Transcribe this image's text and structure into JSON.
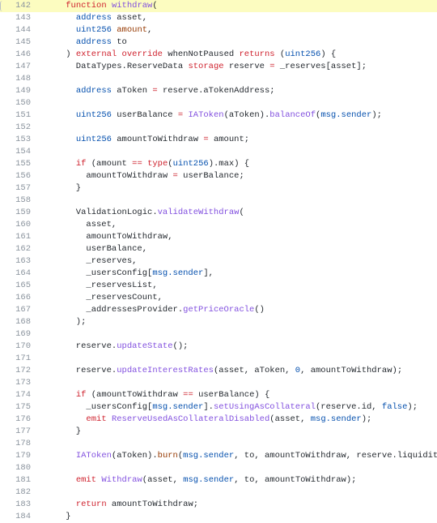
{
  "editor": {
    "language": "solidity",
    "theme": "github-light",
    "background_color": "#ffffff",
    "gutter_color": "#8b949e",
    "highlight_color": "#fcfcc0",
    "highlighted_line": 142,
    "first_line": 142,
    "last_line": 184,
    "fold_marker_icon": "fold-bracket-icon"
  },
  "palette": {
    "keyword": "#cf222e",
    "type": "#0550ae",
    "function": "#8250df",
    "variable": "#953800",
    "plain": "#24292f",
    "global": "#0550ae"
  },
  "lines": [
    {
      "number": "142",
      "highlighted": true,
      "tokens": [
        {
          "t": "    ",
          "c": "plain"
        },
        {
          "t": "function",
          "c": "kw"
        },
        {
          "t": " ",
          "c": "plain"
        },
        {
          "t": "withdraw",
          "c": "fn"
        },
        {
          "t": "(",
          "c": "plain"
        }
      ]
    },
    {
      "number": "143",
      "highlighted": false,
      "tokens": [
        {
          "t": "      ",
          "c": "plain"
        },
        {
          "t": "address",
          "c": "type"
        },
        {
          "t": " asset,",
          "c": "plain"
        }
      ]
    },
    {
      "number": "144",
      "highlighted": false,
      "tokens": [
        {
          "t": "      ",
          "c": "plain"
        },
        {
          "t": "uint256",
          "c": "type"
        },
        {
          "t": " ",
          "c": "plain"
        },
        {
          "t": "amount",
          "c": "var"
        },
        {
          "t": ",",
          "c": "plain"
        }
      ]
    },
    {
      "number": "145",
      "highlighted": false,
      "tokens": [
        {
          "t": "      ",
          "c": "plain"
        },
        {
          "t": "address",
          "c": "type"
        },
        {
          "t": " to",
          "c": "plain"
        }
      ]
    },
    {
      "number": "146",
      "highlighted": false,
      "tokens": [
        {
          "t": "    ) ",
          "c": "plain"
        },
        {
          "t": "external",
          "c": "kw"
        },
        {
          "t": " ",
          "c": "plain"
        },
        {
          "t": "override",
          "c": "kw"
        },
        {
          "t": " whenNotPaused ",
          "c": "plain"
        },
        {
          "t": "returns",
          "c": "kw"
        },
        {
          "t": " (",
          "c": "plain"
        },
        {
          "t": "uint256",
          "c": "type"
        },
        {
          "t": ") {",
          "c": "plain"
        }
      ]
    },
    {
      "number": "147",
      "highlighted": false,
      "tokens": [
        {
          "t": "      DataTypes.ReserveData ",
          "c": "plain"
        },
        {
          "t": "storage",
          "c": "kw"
        },
        {
          "t": " reserve ",
          "c": "plain"
        },
        {
          "t": "=",
          "c": "op"
        },
        {
          "t": " _reserves[asset];",
          "c": "plain"
        }
      ]
    },
    {
      "number": "148",
      "highlighted": false,
      "tokens": []
    },
    {
      "number": "149",
      "highlighted": false,
      "tokens": [
        {
          "t": "      ",
          "c": "plain"
        },
        {
          "t": "address",
          "c": "type"
        },
        {
          "t": " aToken ",
          "c": "plain"
        },
        {
          "t": "=",
          "c": "op"
        },
        {
          "t": " reserve.aTokenAddress;",
          "c": "plain"
        }
      ]
    },
    {
      "number": "150",
      "highlighted": false,
      "tokens": []
    },
    {
      "number": "151",
      "highlighted": false,
      "tokens": [
        {
          "t": "      ",
          "c": "plain"
        },
        {
          "t": "uint256",
          "c": "type"
        },
        {
          "t": " userBalance ",
          "c": "plain"
        },
        {
          "t": "=",
          "c": "op"
        },
        {
          "t": " ",
          "c": "plain"
        },
        {
          "t": "IAToken",
          "c": "fn"
        },
        {
          "t": "(aToken).",
          "c": "plain"
        },
        {
          "t": "balanceOf",
          "c": "fn"
        },
        {
          "t": "(",
          "c": "plain"
        },
        {
          "t": "msg.sender",
          "c": "global"
        },
        {
          "t": ");",
          "c": "plain"
        }
      ]
    },
    {
      "number": "152",
      "highlighted": false,
      "tokens": []
    },
    {
      "number": "153",
      "highlighted": false,
      "tokens": [
        {
          "t": "      ",
          "c": "plain"
        },
        {
          "t": "uint256",
          "c": "type"
        },
        {
          "t": " amountToWithdraw ",
          "c": "plain"
        },
        {
          "t": "=",
          "c": "op"
        },
        {
          "t": " amount;",
          "c": "plain"
        }
      ]
    },
    {
      "number": "154",
      "highlighted": false,
      "tokens": []
    },
    {
      "number": "155",
      "highlighted": false,
      "tokens": [
        {
          "t": "      ",
          "c": "plain"
        },
        {
          "t": "if",
          "c": "kw"
        },
        {
          "t": " (amount ",
          "c": "plain"
        },
        {
          "t": "==",
          "c": "op"
        },
        {
          "t": " ",
          "c": "plain"
        },
        {
          "t": "type",
          "c": "kw"
        },
        {
          "t": "(",
          "c": "plain"
        },
        {
          "t": "uint256",
          "c": "type"
        },
        {
          "t": ").max) {",
          "c": "plain"
        }
      ]
    },
    {
      "number": "156",
      "highlighted": false,
      "tokens": [
        {
          "t": "        amountToWithdraw ",
          "c": "plain"
        },
        {
          "t": "=",
          "c": "op"
        },
        {
          "t": " userBalance;",
          "c": "plain"
        }
      ]
    },
    {
      "number": "157",
      "highlighted": false,
      "tokens": [
        {
          "t": "      }",
          "c": "plain"
        }
      ]
    },
    {
      "number": "158",
      "highlighted": false,
      "tokens": []
    },
    {
      "number": "159",
      "highlighted": false,
      "tokens": [
        {
          "t": "      ValidationLogic.",
          "c": "plain"
        },
        {
          "t": "validateWithdraw",
          "c": "fn"
        },
        {
          "t": "(",
          "c": "plain"
        }
      ]
    },
    {
      "number": "160",
      "highlighted": false,
      "tokens": [
        {
          "t": "        asset,",
          "c": "plain"
        }
      ]
    },
    {
      "number": "161",
      "highlighted": false,
      "tokens": [
        {
          "t": "        amountToWithdraw,",
          "c": "plain"
        }
      ]
    },
    {
      "number": "162",
      "highlighted": false,
      "tokens": [
        {
          "t": "        userBalance,",
          "c": "plain"
        }
      ]
    },
    {
      "number": "163",
      "highlighted": false,
      "tokens": [
        {
          "t": "        _reserves,",
          "c": "plain"
        }
      ]
    },
    {
      "number": "164",
      "highlighted": false,
      "tokens": [
        {
          "t": "        _usersConfig[",
          "c": "plain"
        },
        {
          "t": "msg.sender",
          "c": "global"
        },
        {
          "t": "],",
          "c": "plain"
        }
      ]
    },
    {
      "number": "165",
      "highlighted": false,
      "tokens": [
        {
          "t": "        _reservesList,",
          "c": "plain"
        }
      ]
    },
    {
      "number": "166",
      "highlighted": false,
      "tokens": [
        {
          "t": "        _reservesCount,",
          "c": "plain"
        }
      ]
    },
    {
      "number": "167",
      "highlighted": false,
      "tokens": [
        {
          "t": "        _addressesProvider.",
          "c": "plain"
        },
        {
          "t": "getPriceOracle",
          "c": "fn"
        },
        {
          "t": "()",
          "c": "plain"
        }
      ]
    },
    {
      "number": "168",
      "highlighted": false,
      "tokens": [
        {
          "t": "      );",
          "c": "plain"
        }
      ]
    },
    {
      "number": "169",
      "highlighted": false,
      "tokens": []
    },
    {
      "number": "170",
      "highlighted": false,
      "tokens": [
        {
          "t": "      reserve.",
          "c": "plain"
        },
        {
          "t": "updateState",
          "c": "fn"
        },
        {
          "t": "();",
          "c": "plain"
        }
      ]
    },
    {
      "number": "171",
      "highlighted": false,
      "tokens": []
    },
    {
      "number": "172",
      "highlighted": false,
      "tokens": [
        {
          "t": "      reserve.",
          "c": "plain"
        },
        {
          "t": "updateInterestRates",
          "c": "fn"
        },
        {
          "t": "(asset, aToken, ",
          "c": "plain"
        },
        {
          "t": "0",
          "c": "type"
        },
        {
          "t": ", amountToWithdraw);",
          "c": "plain"
        }
      ]
    },
    {
      "number": "173",
      "highlighted": false,
      "tokens": []
    },
    {
      "number": "174",
      "highlighted": false,
      "tokens": [
        {
          "t": "      ",
          "c": "plain"
        },
        {
          "t": "if",
          "c": "kw"
        },
        {
          "t": " (amountToWithdraw ",
          "c": "plain"
        },
        {
          "t": "==",
          "c": "op"
        },
        {
          "t": " userBalance) {",
          "c": "plain"
        }
      ]
    },
    {
      "number": "175",
      "highlighted": false,
      "tokens": [
        {
          "t": "        _usersConfig[",
          "c": "plain"
        },
        {
          "t": "msg.sender",
          "c": "global"
        },
        {
          "t": "].",
          "c": "plain"
        },
        {
          "t": "setUsingAsCollateral",
          "c": "fn"
        },
        {
          "t": "(reserve.id, ",
          "c": "plain"
        },
        {
          "t": "false",
          "c": "type"
        },
        {
          "t": ");",
          "c": "plain"
        }
      ]
    },
    {
      "number": "176",
      "highlighted": false,
      "tokens": [
        {
          "t": "        ",
          "c": "plain"
        },
        {
          "t": "emit",
          "c": "kw"
        },
        {
          "t": " ",
          "c": "plain"
        },
        {
          "t": "ReserveUsedAsCollateralDisabled",
          "c": "fn"
        },
        {
          "t": "(asset, ",
          "c": "plain"
        },
        {
          "t": "msg.sender",
          "c": "global"
        },
        {
          "t": ");",
          "c": "plain"
        }
      ]
    },
    {
      "number": "177",
      "highlighted": false,
      "tokens": [
        {
          "t": "      }",
          "c": "plain"
        }
      ]
    },
    {
      "number": "178",
      "highlighted": false,
      "tokens": []
    },
    {
      "number": "179",
      "highlighted": false,
      "tokens": [
        {
          "t": "      ",
          "c": "plain"
        },
        {
          "t": "IAToken",
          "c": "fn"
        },
        {
          "t": "(aToken).",
          "c": "plain"
        },
        {
          "t": "burn",
          "c": "var"
        },
        {
          "t": "(",
          "c": "plain"
        },
        {
          "t": "msg.sender",
          "c": "global"
        },
        {
          "t": ", to, amountToWithdraw, reserve.liquidityIndex);",
          "c": "plain"
        }
      ]
    },
    {
      "number": "180",
      "highlighted": false,
      "tokens": []
    },
    {
      "number": "181",
      "highlighted": false,
      "tokens": [
        {
          "t": "      ",
          "c": "plain"
        },
        {
          "t": "emit",
          "c": "kw"
        },
        {
          "t": " ",
          "c": "plain"
        },
        {
          "t": "Withdraw",
          "c": "fn"
        },
        {
          "t": "(asset, ",
          "c": "plain"
        },
        {
          "t": "msg.sender",
          "c": "global"
        },
        {
          "t": ", to, amountToWithdraw);",
          "c": "plain"
        }
      ]
    },
    {
      "number": "182",
      "highlighted": false,
      "tokens": []
    },
    {
      "number": "183",
      "highlighted": false,
      "tokens": [
        {
          "t": "      ",
          "c": "plain"
        },
        {
          "t": "return",
          "c": "kw"
        },
        {
          "t": " amountToWithdraw;",
          "c": "plain"
        }
      ]
    },
    {
      "number": "184",
      "highlighted": false,
      "tokens": [
        {
          "t": "    }",
          "c": "plain"
        }
      ]
    }
  ]
}
